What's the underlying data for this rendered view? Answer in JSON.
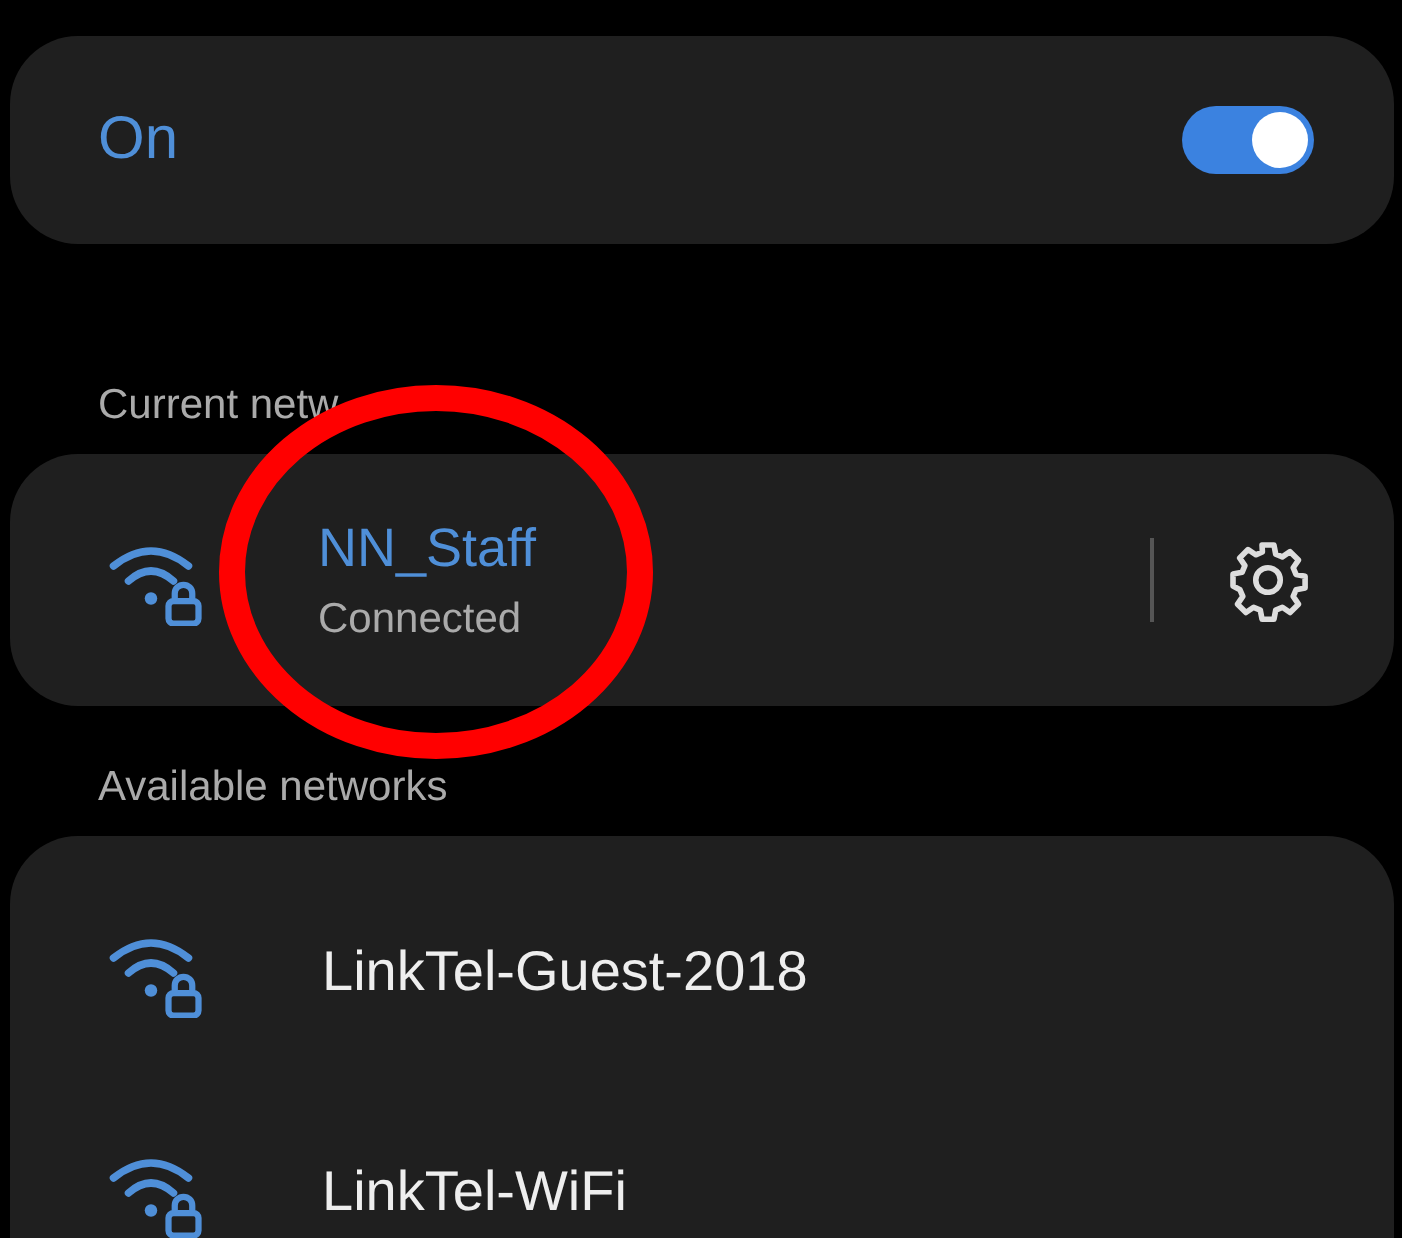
{
  "master_switch": {
    "label": "On",
    "on": true
  },
  "current_section": {
    "heading": "Current netw",
    "network": {
      "name": "NN_Staff",
      "status": "Connected",
      "secured": true
    }
  },
  "available_section": {
    "heading": "Available networks",
    "networks": [
      {
        "name": "LinkTel-Guest-2018",
        "secured": true
      },
      {
        "name": "LinkTel-WiFi",
        "secured": true
      }
    ]
  },
  "annotation": {
    "kind": "circle",
    "color": "#ff0000"
  }
}
